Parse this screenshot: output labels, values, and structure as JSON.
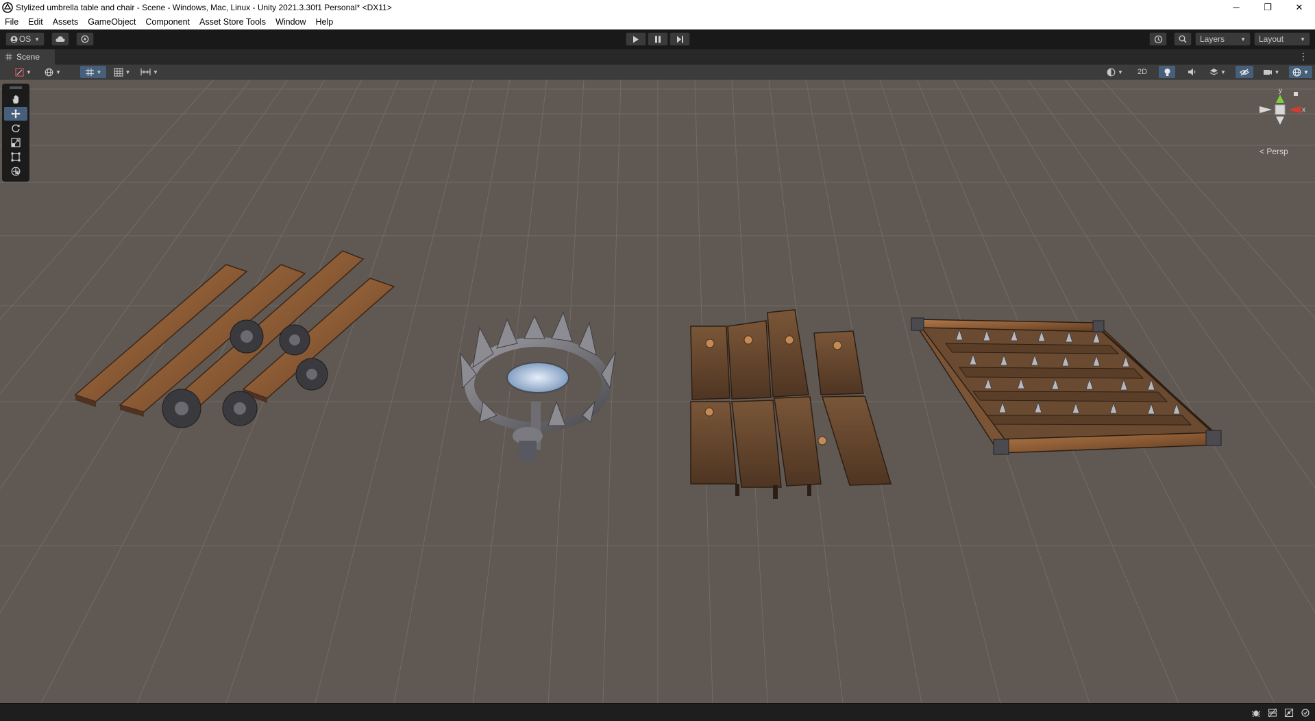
{
  "window": {
    "title": "Stylized umbrella table and chair - Scene - Windows, Mac, Linux - Unity 2021.3.30f1 Personal* <DX11>",
    "minimize": "─",
    "restore": "❐",
    "close": "✕"
  },
  "menu": [
    "File",
    "Edit",
    "Assets",
    "GameObject",
    "Component",
    "Asset Store Tools",
    "Window",
    "Help"
  ],
  "toolbar": {
    "account_label": "OS",
    "layers_label": "Layers",
    "layout_label": "Layout"
  },
  "scene_tab": {
    "label": "Scene"
  },
  "scene_toolbar": {
    "mode_2d_label": "2D"
  },
  "viewport": {
    "projection_label": "Persp",
    "gizmo_x": "x",
    "gizmo_y": "y",
    "colors": {
      "background": "#5f5853",
      "grid": "#7a736d",
      "wood": "#8a5a34",
      "metal": "#6e6e72",
      "axis_x": "#d83b2e",
      "axis_y": "#7bd13a",
      "active_tool": "#46607c"
    }
  },
  "tools": [
    "view-tool",
    "move-tool",
    "rotate-tool",
    "scale-tool",
    "rect-tool",
    "transform-tool"
  ]
}
